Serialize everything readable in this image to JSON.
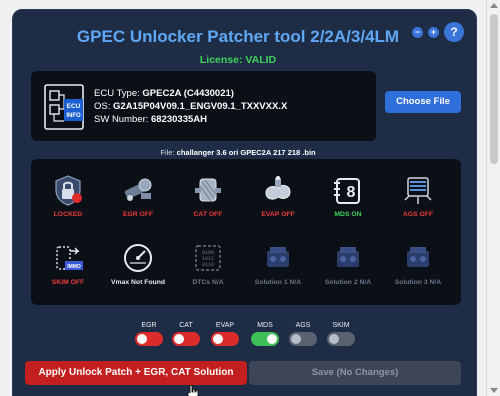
{
  "header": {
    "title": "GPEC Unlocker Patcher tool 2/2A/3/4LM",
    "minimize_label": "−",
    "maximize_label": "+",
    "help_label": "?"
  },
  "license": {
    "text": "License: VALID",
    "color": "#3fd35c"
  },
  "ecu": {
    "icon_label_1": "ECU",
    "icon_label_2": "INFO",
    "type_key": "ECU Type: ",
    "type_value": "GPEC2A (C4430021)",
    "os_key": "OS: ",
    "os_value": "G2A15P04V09.1_ENGV09.1_TXXVXX.X",
    "sw_key": "SW Number: ",
    "sw_value": "68230335AH"
  },
  "actions": {
    "choose_file_label": "Choose File",
    "apply_label": "Apply Unlock Patch + EGR, CAT Solution",
    "save_label": "Save (No Changes)"
  },
  "file": {
    "prefix": "File: ",
    "name": "challanger 3.6 ori GPEC2A 217 218 .bin"
  },
  "features": [
    {
      "label": "LOCKED",
      "state": "red",
      "icon": "lock-shield-icon"
    },
    {
      "label": "EGR OFF",
      "state": "red",
      "icon": "egr-valve-icon"
    },
    {
      "label": "CAT OFF",
      "state": "red",
      "icon": "catalytic-converter-icon"
    },
    {
      "label": "EVAP OFF",
      "state": "red",
      "icon": "evap-canister-icon"
    },
    {
      "label": "MDS ON",
      "state": "green",
      "icon": "mds-cylinder-icon"
    },
    {
      "label": "AGS OFF",
      "state": "red",
      "icon": "ags-shutter-icon"
    },
    {
      "label": "SKIM OFF",
      "state": "red",
      "icon": "skim-immobilizer-icon",
      "chip_text": "IMMO"
    },
    {
      "label": "Vmax Not Found",
      "state": "white",
      "icon": "speedometer-icon"
    },
    {
      "label": "DTCs N/A",
      "state": "grey",
      "icon": "binary-chip-icon",
      "chip_text": "0100 1011 0110"
    },
    {
      "label": "Solution 1 N/A",
      "state": "grey",
      "icon": "engine-1-icon"
    },
    {
      "label": "Solution 2 N/A",
      "state": "grey",
      "icon": "engine-2-icon"
    },
    {
      "label": "Solution 3 N/A",
      "state": "grey",
      "icon": "engine-3-icon"
    }
  ],
  "toggles": [
    {
      "label": "EGR",
      "on": false,
      "color": "red"
    },
    {
      "label": "CAT",
      "on": false,
      "color": "red"
    },
    {
      "label": "EVAP",
      "on": false,
      "color": "red"
    },
    {
      "label": "MDS",
      "on": true,
      "color": "green"
    },
    {
      "label": "AGS",
      "on": false,
      "color": "grey"
    },
    {
      "label": "SKIM",
      "on": false,
      "color": "grey"
    }
  ],
  "colors": {
    "panel": "#1e2d45",
    "accent_blue": "#2f6fdc",
    "title_blue": "#5fa8f5",
    "status_red": "#ee3b3b",
    "status_green": "#3fd35c",
    "apply_red": "#c41f1f"
  }
}
